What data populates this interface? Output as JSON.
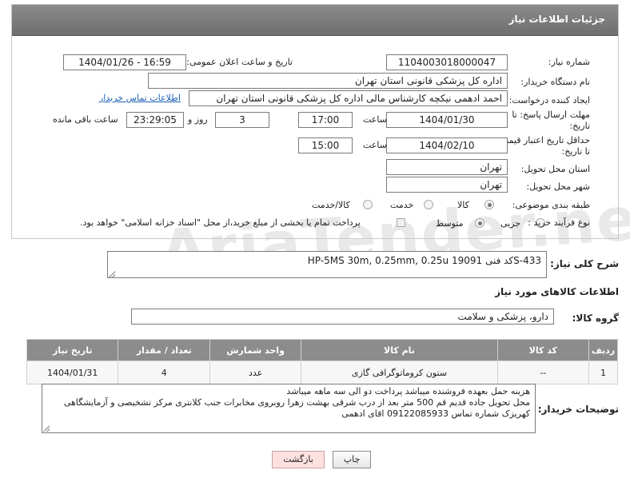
{
  "watermark": "AriaTender.neT",
  "header": {
    "title": "جزئیات اطلاعات نیاز"
  },
  "form": {
    "need_number": {
      "label": "شماره نیاز:",
      "value": "1104003018000047"
    },
    "announce_datetime": {
      "label": "تاریخ و ساعت اعلان عمومی:",
      "value": "1404/01/26 - 16:59"
    },
    "buyer_org": {
      "label": "نام دستگاه خریدار:",
      "value": "اداره کل پزشکی قانونی استان تهران"
    },
    "requester": {
      "label": "ایجاد کننده درخواست:",
      "value": "احمد ادهمی نیکچه کارشناس مالی اداره کل پزشکی قانونی استان تهران",
      "contact_link": "اطلاعات تماس خریدار"
    },
    "reply_deadline": {
      "label_line1": "مهلت ارسال پاسخ: تا",
      "label_line2": "تاریخ:",
      "date": "1404/01/30",
      "time_label": "ساعت",
      "time": "17:00",
      "days": "3",
      "days_label": "روز و",
      "remaining": "23:29:05",
      "remaining_label": "ساعت باقی مانده"
    },
    "price_validity": {
      "label_line1": "حداقل تاریخ اعتبار قیمت:",
      "label_line2": "تا تاریخ:",
      "date": "1404/02/10",
      "time_label": "ساعت",
      "time": "15:00"
    },
    "delivery_province": {
      "label": "استان محل تحویل:",
      "value": "تهران"
    },
    "delivery_city": {
      "label": "شهر محل تحویل:",
      "value": "تهران"
    },
    "category": {
      "label": "طبقه بندی موضوعی:",
      "options": [
        "کالا",
        "خدمت",
        "کالا/خدمت"
      ],
      "selected": "کالا"
    },
    "purchase_process": {
      "label": "نوع فرآیند خرید :",
      "options": [
        "جزیی",
        "متوسط"
      ],
      "selected": "متوسط",
      "payment_note": "پرداخت تمام یا بخشی از مبلغ خرید،از محل \"اسناد خزانه اسلامی\" خواهد بود."
    }
  },
  "general_description": {
    "label": "شرح کلی نیاز:",
    "value": "HP-5MS 30m, 0.25mm, 0.25u کد فنی 19091S-433"
  },
  "goods_section": {
    "title": "اطلاعات کالاهای مورد نیاز"
  },
  "goods_group": {
    "label": "گروه کالا:",
    "value": "دارو، پزشکی و سلامت"
  },
  "items_table": {
    "headers": [
      "ردیف",
      "کد کالا",
      "نام کالا",
      "واحد شمارش",
      "تعداد / مقدار",
      "تاریخ نیاز"
    ],
    "rows": [
      [
        "1",
        "--",
        "ستون کروماتوگرافی گازی",
        "عدد",
        "4",
        "1404/01/31"
      ]
    ]
  },
  "buyer_notes": {
    "label": "توضیحات خریدار:",
    "value": "هزینه حمل بعهده فروشنده میباشد پرداخت دو الی سه ماهه میباشد\nمحل تحویل جاده قدیم قم 500 متر بعد از درب شرقی بهشت زهرا روبروی مخابرات جنب کلانتری مرکز تشخیصی و آزمایشگاهی کهریزک شماره تماس 09122085933 اقای ادهمی"
  },
  "buttons": {
    "print": "چاپ",
    "back": "بازگشت"
  },
  "colors": {
    "header": "#7a7a7a",
    "link": "#1a5fb4",
    "back_button_bg": "#fde0e0"
  }
}
